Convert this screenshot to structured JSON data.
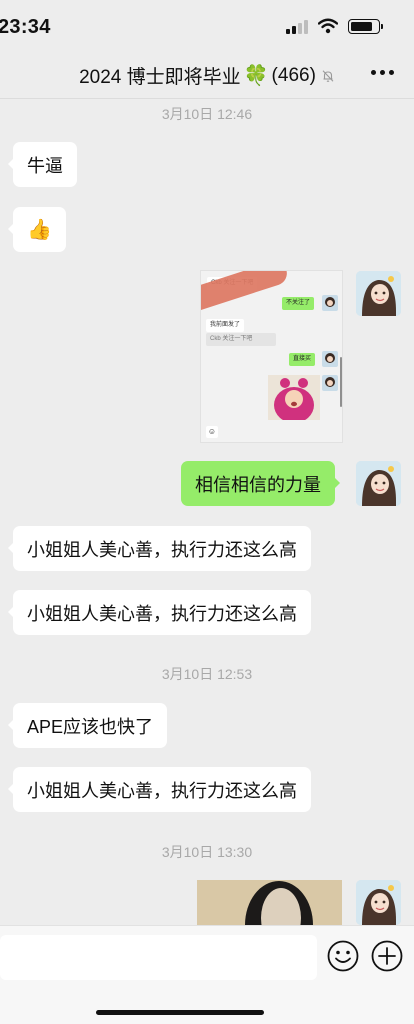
{
  "status_bar": {
    "time": "23:34",
    "battery_level": 0.8
  },
  "header": {
    "title": "2024 博士即将毕业",
    "member_count": "(466)",
    "title_emoji": "🍀"
  },
  "timestamps": [
    "3月10日 12:46",
    "3月10日 12:53",
    "3月10日 13:30"
  ],
  "messages": {
    "m1": "牛逼",
    "m2": "👍",
    "m4": "相信相信的力量",
    "m5": "小姐姐人美心善，执行力还这么高",
    "m6": "小姐姐人美心善，执行力还这么高",
    "m7": "APE应该也快了",
    "m8": "小姐姐人美心善，执行力还这么高"
  },
  "screenshot_preview": {
    "b1": "Ckb 关注一下吧",
    "b2": "不关注了",
    "b3": "我前面发了",
    "b4": "Ckb 关注一下吧",
    "b5": "直接买"
  },
  "colors": {
    "self_bubble": "#95ec69",
    "other_bubble": "#ffffff",
    "background": "#ededed"
  }
}
